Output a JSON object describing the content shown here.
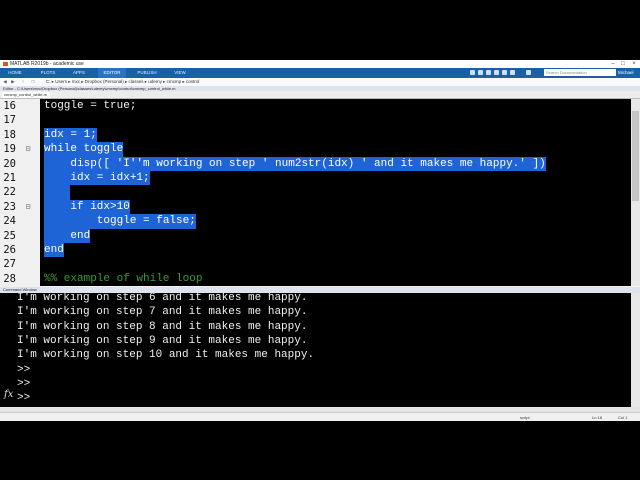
{
  "window": {
    "title": "MATLAB R2019b - academic use"
  },
  "ribbon": {
    "tabs": [
      "HOME",
      "PLOTS",
      "APPS",
      "EDITOR",
      "PUBLISH",
      "VIEW"
    ],
    "active": "EDITOR",
    "search_placeholder": "Search Documentation",
    "user": "Michael"
  },
  "address": {
    "path": "C: ▸ Users ▸ mxc ▸ Dropbox (Personal) ▸ classes ▸ udemy ▸ cmxmp ▸ control"
  },
  "editor": {
    "title": "Editor - C:\\Users\\mxc\\Dropbox (Personal)\\classes\\udemy\\cmxmp\\control\\cmxmp_control_while.m",
    "tab": "cmxmp_control_while.m",
    "lines": [
      {
        "num": "16",
        "text": "toggle = true;",
        "selected": false
      },
      {
        "num": "17",
        "text": "",
        "selected": false
      },
      {
        "num": "18",
        "text": "idx = 1;",
        "selected": true
      },
      {
        "num": "19",
        "text": "while toggle",
        "selected": true,
        "fold": "⊟"
      },
      {
        "num": "20",
        "text": "    disp([ 'I''m working on step ' num2str(idx) ' and it makes me happy.' ])",
        "selected": true
      },
      {
        "num": "21",
        "text": "    idx = idx+1;",
        "selected": true
      },
      {
        "num": "22",
        "text": "    ",
        "selected": true
      },
      {
        "num": "23",
        "text": "    if idx>10",
        "selected": true,
        "fold": "⊟"
      },
      {
        "num": "24",
        "text": "        toggle = false;",
        "selected": true
      },
      {
        "num": "25",
        "text": "    end",
        "selected": true
      },
      {
        "num": "26",
        "text": "end",
        "selected": true
      },
      {
        "num": "27",
        "text": "",
        "selected": false
      },
      {
        "num": "28",
        "text": "%% example of while loop",
        "selected": false,
        "comment": true
      }
    ]
  },
  "command_window": {
    "title": "Command Window",
    "lines": [
      "I'm working on step 6 and it makes me happy.",
      "I'm working on step 7 and it makes me happy.",
      "I'm working on step 8 and it makes me happy.",
      "I'm working on step 9 and it makes me happy.",
      "I'm working on step 10 and it makes me happy.",
      ">>",
      ">>",
      ">>"
    ],
    "fx_label": "fx"
  },
  "status_bar": {
    "mode": "script",
    "ln": "Ln 18",
    "col": "Col 1"
  },
  "colors": {
    "selection": "#1e64d6",
    "ribbon": "#1b5fa6",
    "comment": "#3a9a3a"
  }
}
